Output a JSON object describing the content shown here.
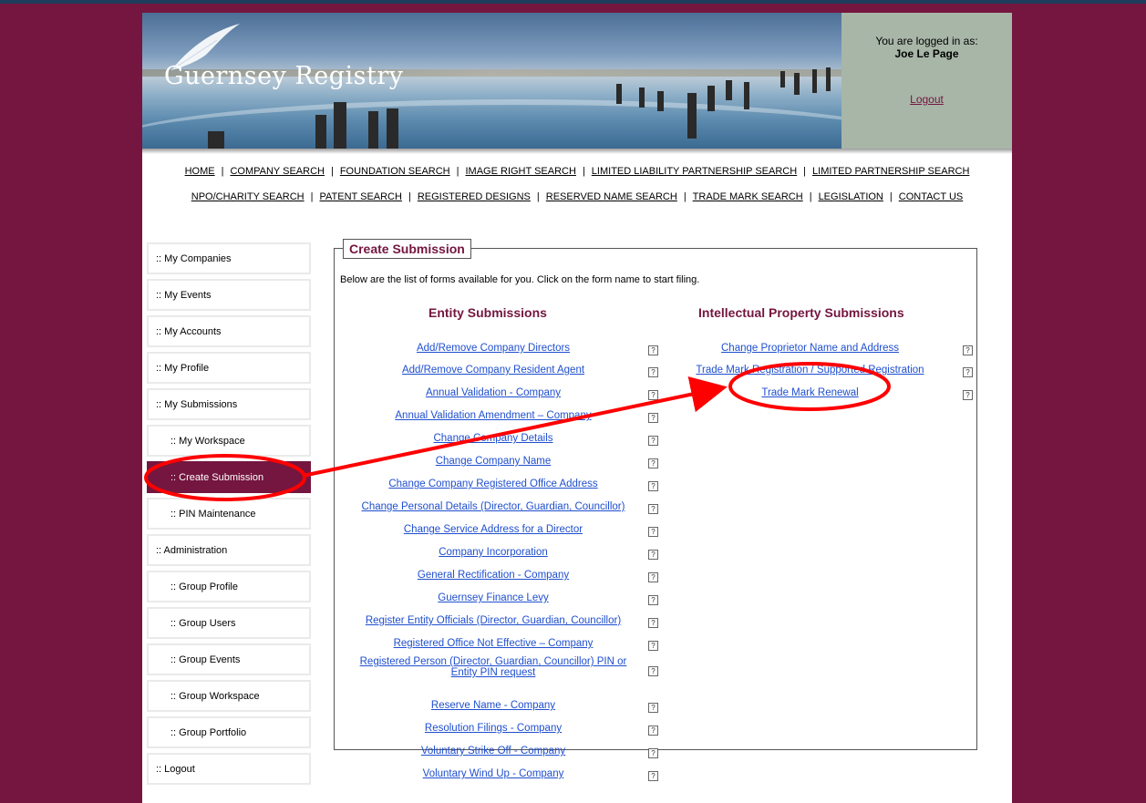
{
  "header": {
    "logo_text": "Guernsey Registry",
    "logged_in_label": "You are logged in as:",
    "user_name": "Joe Le Page",
    "logout_label": "Logout"
  },
  "nav": {
    "row1": [
      "HOME",
      "COMPANY SEARCH",
      "FOUNDATION SEARCH",
      "IMAGE RIGHT SEARCH",
      "LIMITED LIABILITY PARTNERSHIP SEARCH",
      "LIMITED PARTNERSHIP SEARCH"
    ],
    "row2": [
      "NPO/CHARITY SEARCH",
      "PATENT SEARCH",
      "REGISTERED DESIGNS",
      "RESERVED NAME SEARCH",
      "TRADE MARK SEARCH",
      "LEGISLATION",
      "CONTACT US"
    ]
  },
  "sidebar": [
    {
      "label": ":: My Companies",
      "sub": false,
      "active": false
    },
    {
      "label": ":: My Events",
      "sub": false,
      "active": false
    },
    {
      "label": ":: My Accounts",
      "sub": false,
      "active": false
    },
    {
      "label": ":: My Profile",
      "sub": false,
      "active": false
    },
    {
      "label": ":: My Submissions",
      "sub": false,
      "active": false
    },
    {
      "label": ":: My Workspace",
      "sub": true,
      "active": false
    },
    {
      "label": ":: Create Submission",
      "sub": true,
      "active": true
    },
    {
      "label": ":: PIN Maintenance",
      "sub": true,
      "active": false
    },
    {
      "label": ":: Administration",
      "sub": false,
      "active": false
    },
    {
      "label": ":: Group Profile",
      "sub": true,
      "active": false
    },
    {
      "label": ":: Group Users",
      "sub": true,
      "active": false
    },
    {
      "label": ":: Group Events",
      "sub": true,
      "active": false
    },
    {
      "label": ":: Group Workspace",
      "sub": true,
      "active": false
    },
    {
      "label": ":: Group Portfolio",
      "sub": true,
      "active": false
    },
    {
      "label": ":: Logout",
      "sub": false,
      "active": false
    }
  ],
  "main": {
    "title": "Create Submission",
    "intro": "Below are the list of forms available for you. Click on the form name to start filing.",
    "entity_title": "Entity Submissions",
    "ip_title": "Intellectual Property Submissions",
    "help_glyph": "?",
    "entity_forms": [
      "Add/Remove Company Directors",
      "Add/Remove Company Resident Agent",
      "Annual Validation - Company",
      "Annual Validation Amendment – Company",
      "Change Company Details",
      "Change Company Name",
      "Change Company Registered Office Address",
      "Change Personal Details (Director, Guardian, Councillor)",
      "Change Service Address for a Director",
      "Company Incorporation",
      "General Rectification - Company",
      "Guernsey Finance Levy",
      "Register Entity Officials (Director, Guardian, Councillor)",
      "Registered Office Not Effective – Company",
      "Registered Person (Director, Guardian, Councillor) PIN or Entity PIN request",
      "Reserve Name - Company",
      "Resolution Filings - Company",
      "Voluntary Strike Off - Company",
      "Voluntary Wind Up - Company"
    ],
    "ip_forms": [
      "Change Proprietor Name and Address",
      "Trade Mark Registration / Supported Registration",
      "Trade Mark Renewal"
    ]
  },
  "colors": {
    "brand": "#74163f",
    "link": "#1f4fcf",
    "annotation": "#ff0000"
  }
}
